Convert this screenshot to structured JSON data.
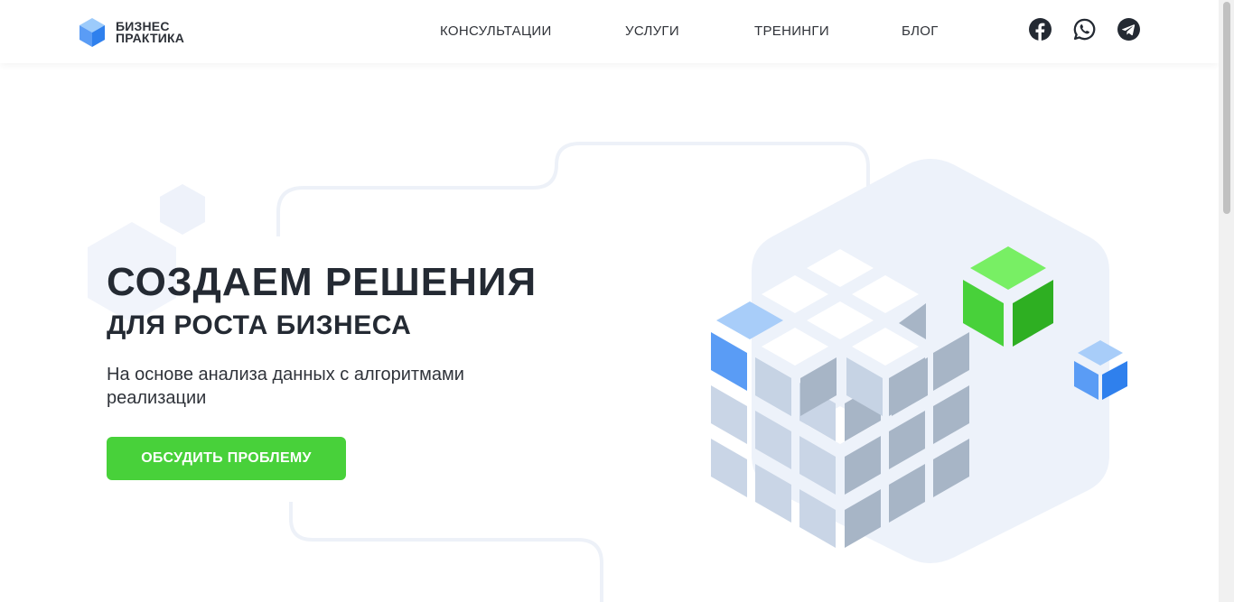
{
  "header": {
    "logo": {
      "line1": "БИЗНЕС",
      "line2": "ПРАКТИКА",
      "icon": "cube-logo-icon"
    },
    "nav": [
      {
        "label": "КОНСУЛЬТАЦИИ"
      },
      {
        "label": "УСЛУГИ"
      },
      {
        "label": "ТРЕНИНГИ"
      },
      {
        "label": "БЛОГ"
      }
    ],
    "social": [
      {
        "icon": "facebook-icon"
      },
      {
        "icon": "whatsapp-icon"
      },
      {
        "icon": "telegram-icon"
      }
    ]
  },
  "hero": {
    "title": "СОЗДАЕМ РЕШЕНИЯ",
    "subtitle": "ДЛЯ РОСТА БИЗНЕСА",
    "description": "На основе анализа данных с алгоритмами реализации",
    "cta_label": "ОБСУДИТЬ ПРОБЛЕМУ"
  },
  "colors": {
    "accent_green": "#48d13a",
    "text_dark": "#242a33",
    "cube_blue": "#5a9cf5",
    "cube_grey": "#a7b5c6",
    "bg_hex": "#edf2fa"
  }
}
